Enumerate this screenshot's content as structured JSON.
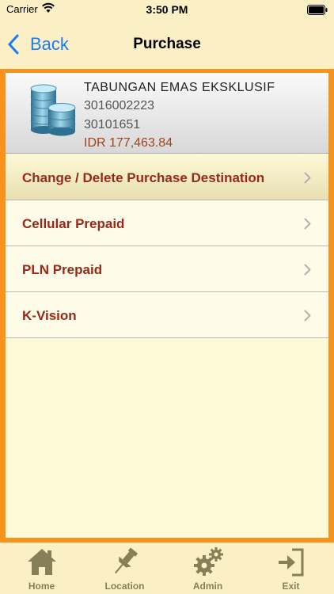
{
  "status_bar": {
    "carrier": "Carrier",
    "time": "3:50 PM"
  },
  "nav": {
    "back_label": "Back",
    "title": "Purchase"
  },
  "account": {
    "name": "TABUNGAN EMAS EKSKLUSIF",
    "number": "3016002223",
    "sub_number": "30101651",
    "balance": "IDR 177,463.84",
    "icon": "coins-icon"
  },
  "menu": {
    "items": [
      {
        "label": "Change / Delete Purchase Destination"
      },
      {
        "label": "Cellular Prepaid"
      },
      {
        "label": "PLN Prepaid"
      },
      {
        "label": "K-Vision"
      }
    ]
  },
  "tab_bar": {
    "items": [
      {
        "label": "Home",
        "icon": "home-icon"
      },
      {
        "label": "Location",
        "icon": "pushpin-icon"
      },
      {
        "label": "Admin",
        "icon": "gears-icon"
      },
      {
        "label": "Exit",
        "icon": "exit-icon"
      }
    ]
  },
  "colors": {
    "accent": "#f6931d",
    "background": "#fdf8d6",
    "menu_text": "#9a2818",
    "link_blue": "#1a7cf5",
    "tab_icon": "#877f58"
  }
}
